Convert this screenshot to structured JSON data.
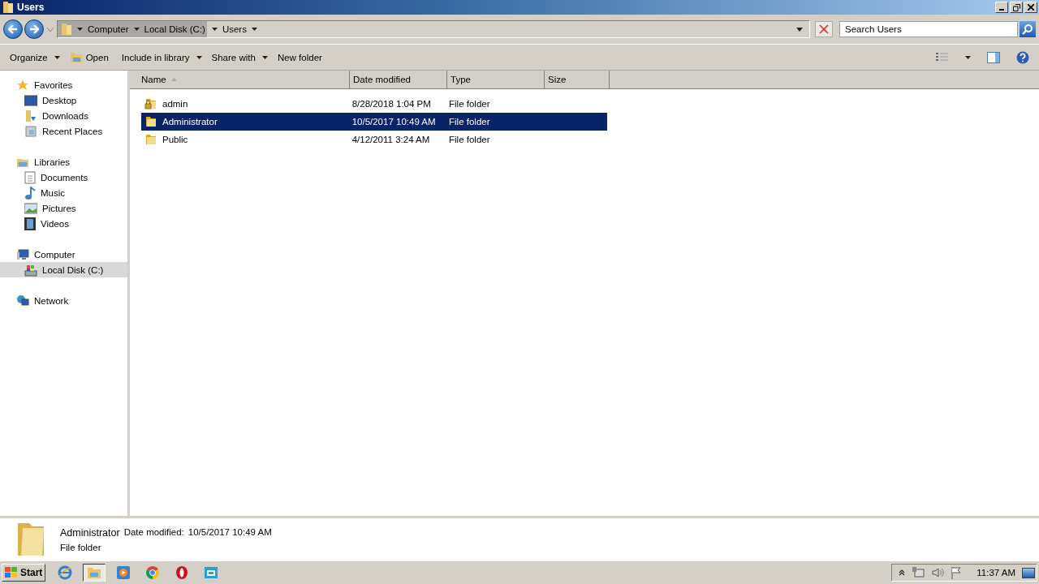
{
  "window": {
    "title": "Users"
  },
  "address": {
    "crumbs": [
      "Computer",
      "Local Disk (C:)",
      "Users"
    ]
  },
  "search": {
    "placeholder": "Search Users"
  },
  "toolbar": [
    {
      "label": "Organize",
      "kind": "menu"
    },
    {
      "label": "Open",
      "kind": "open"
    },
    {
      "label": "Include in library",
      "kind": "menu"
    },
    {
      "label": "Share with",
      "kind": "menu"
    },
    {
      "label": "New folder",
      "kind": "plain"
    }
  ],
  "sidebar": [
    {
      "label": "Favorites",
      "selected": false,
      "children": [
        {
          "label": "Desktop",
          "selected": false
        },
        {
          "label": "Downloads",
          "selected": false
        },
        {
          "label": "Recent Places",
          "selected": false
        }
      ]
    },
    {
      "label": "Libraries",
      "selected": false,
      "children": [
        {
          "label": "Documents",
          "selected": false
        },
        {
          "label": "Music",
          "selected": false
        },
        {
          "label": "Pictures",
          "selected": false
        },
        {
          "label": "Videos",
          "selected": false
        }
      ]
    },
    {
      "label": "Computer",
      "selected": false,
      "children": [
        {
          "label": "Local Disk (C:)",
          "selected": true
        }
      ]
    },
    {
      "label": "Network",
      "selected": false
    }
  ],
  "columns": [
    {
      "label": "Name",
      "sorted": true
    },
    {
      "label": "Date modified",
      "sorted": false
    },
    {
      "label": "Type",
      "sorted": false
    },
    {
      "label": "Size",
      "sorted": false
    }
  ],
  "rows": [
    {
      "name": "admin",
      "date": "8/28/2018 1:04 PM",
      "type": "File folder",
      "locked": true,
      "selected": false
    },
    {
      "name": "Administrator",
      "date": "10/5/2017 10:49 AM",
      "type": "File folder",
      "locked": false,
      "selected": true
    },
    {
      "name": "Public",
      "date": "4/12/2011 3:24 AM",
      "type": "File folder",
      "locked": false,
      "selected": false
    }
  ],
  "details": {
    "name": "Administrator",
    "date_label": "Date modified:",
    "date": "10/5/2017 10:49 AM",
    "type": "File folder"
  },
  "taskbar": {
    "start": "Start",
    "apps": [
      {
        "selected": false
      },
      {
        "selected": true
      },
      {
        "selected": false
      },
      {
        "selected": false
      },
      {
        "selected": false
      },
      {
        "selected": false
      }
    ],
    "time": "11:37 AM"
  }
}
